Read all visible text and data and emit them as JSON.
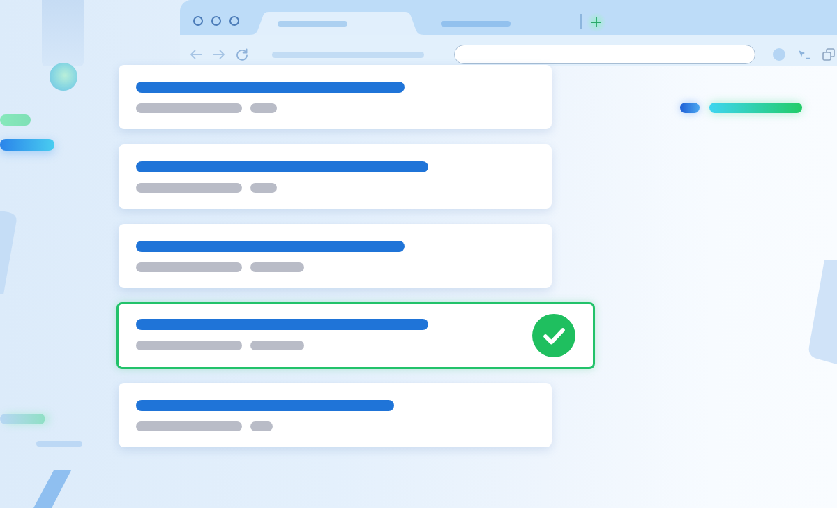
{
  "browser": {
    "tabs": [
      {
        "selected": true
      },
      {
        "selected": false
      }
    ]
  },
  "results": [
    {
      "selected": false
    },
    {
      "selected": false
    },
    {
      "selected": false
    },
    {
      "selected": true
    },
    {
      "selected": false
    }
  ]
}
